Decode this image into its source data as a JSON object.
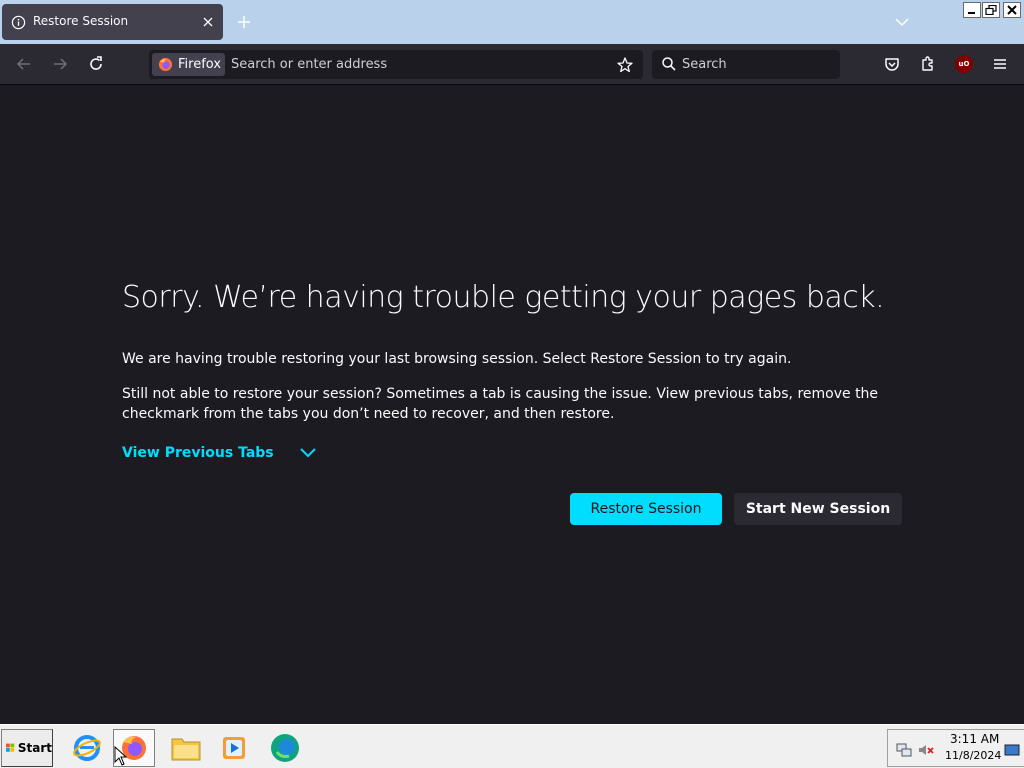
{
  "tab": {
    "title": "Restore Session"
  },
  "toolbar": {
    "identity_label": "Firefox",
    "url_placeholder": "Search or enter address",
    "search_placeholder": "Search",
    "ublock_label": "uO"
  },
  "content": {
    "headline": "Sorry. We’re having trouble getting your pages back.",
    "paragraph1": "We are having trouble restoring your last browsing session. Select Restore Session to try again.",
    "paragraph2": "Still not able to restore your session? Sometimes a tab is causing the issue. View previous tabs, remove the checkmark from the tabs you don’t need to recover, and then restore.",
    "view_previous_tabs": "View Previous Tabs",
    "restore_session_button": "Restore Session",
    "start_new_session_button": "Start New Session"
  },
  "taskbar": {
    "start_label": "Start",
    "time": "3:11 AM",
    "date": "11/8/2024",
    "apps": [
      "internet-explorer-icon",
      "firefox-icon",
      "file-explorer-icon",
      "media-player-icon",
      "edge-icon"
    ]
  },
  "colors": {
    "accent": "#00ddff",
    "page_bg": "#1c1b22",
    "toolbar_bg": "#2b2a33",
    "tab_bg": "#42414d",
    "text": "#fbfbfe"
  }
}
